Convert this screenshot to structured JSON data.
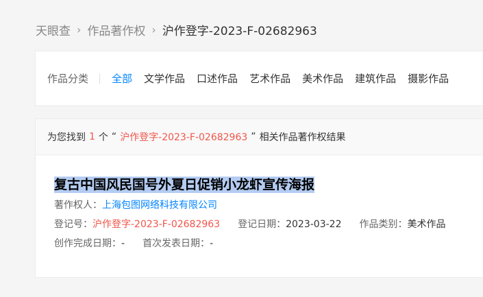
{
  "breadcrumb": {
    "home": "天眼查",
    "section": "作品著作权",
    "current": "沪作登字-2023-F-02682963",
    "separator": "›"
  },
  "filter": {
    "label": "作品分类",
    "items": [
      "全部",
      "文学作品",
      "口述作品",
      "艺术作品",
      "美术作品",
      "建筑作品",
      "摄影作品"
    ],
    "active": "全部"
  },
  "summary": {
    "prefix": "为您找到",
    "count": "1",
    "unit": "个",
    "quote_open": "“",
    "query": "沪作登字-2023-F-02682963",
    "quote_close": "”",
    "suffix": "相关作品著作权结果"
  },
  "result": {
    "title": "复古中国风民国号外夏日促销小龙虾宣传海报",
    "owner_label": "著作权人：",
    "owner": "上海包图网络科技有限公司",
    "reg_no_label": "登记号：",
    "reg_no": "沪作登字-2023-F-02682963",
    "reg_date_label": "登记日期：",
    "reg_date": "2023-03-22",
    "category_label": "作品类别：",
    "category": "美术作品",
    "completion_label": "创作完成日期：",
    "completion": "-",
    "first_pub_label": "首次发表日期：",
    "first_pub": "-"
  },
  "colors": {
    "accent": "#0084ff",
    "highlight": "#f0554a",
    "selection": "#b4ccf2"
  }
}
